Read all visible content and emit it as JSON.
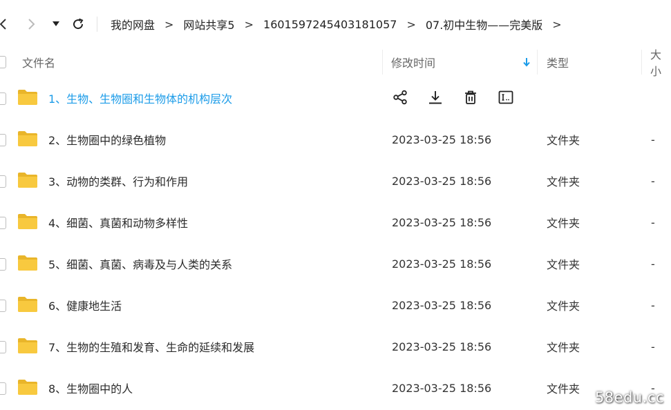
{
  "breadcrumb": {
    "items": [
      "我的网盘",
      "网站共享5",
      "1601597245403181057",
      "07.初中生物——完美版"
    ],
    "separator": ">"
  },
  "columns": {
    "name": "文件名",
    "modified": "修改时间",
    "type": "类型",
    "size": "大小"
  },
  "files": [
    {
      "name": "1、生物、生物圈和生物体的机构层次",
      "modified": "",
      "type": "",
      "size": "",
      "hovered": true
    },
    {
      "name": "2、生物圈中的绿色植物",
      "modified": "2023-03-25 18:56",
      "type": "文件夹",
      "size": "-"
    },
    {
      "name": "3、动物的类群、行为和作用",
      "modified": "2023-03-25 18:56",
      "type": "文件夹",
      "size": "-"
    },
    {
      "name": "4、细菌、真菌和动物多样性",
      "modified": "2023-03-25 18:56",
      "type": "文件夹",
      "size": "-"
    },
    {
      "name": "5、细菌、真菌、病毒及与人类的关系",
      "modified": "2023-03-25 18:56",
      "type": "文件夹",
      "size": "-"
    },
    {
      "name": "6、健康地生活",
      "modified": "2023-03-25 18:56",
      "type": "文件夹",
      "size": "-"
    },
    {
      "name": "7、生物的生殖和发育、生命的延续和发展",
      "modified": "2023-03-25 18:56",
      "type": "文件夹",
      "size": "-"
    },
    {
      "name": "8、生物圈中的人",
      "modified": "2023-03-25 18:56",
      "type": "文件夹",
      "size": "-"
    }
  ],
  "row_actions": [
    "share-icon",
    "download-icon",
    "delete-icon",
    "rename-icon"
  ],
  "sort": {
    "column": "modified",
    "direction": "descending"
  },
  "colors": {
    "accent": "#1a9be8",
    "folder": "#f8c93f",
    "folder_dark": "#e9b52a"
  },
  "watermark": "58edu.cc"
}
